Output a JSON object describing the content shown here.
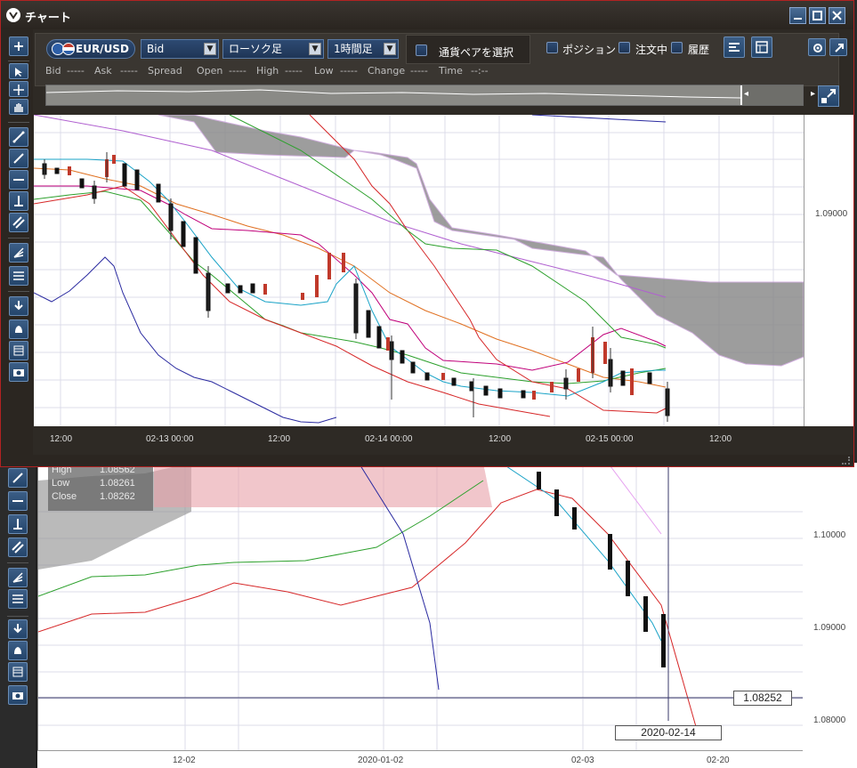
{
  "window": {
    "title": "チャート",
    "buttons": [
      "minimize",
      "maximize",
      "close"
    ]
  },
  "toolbar": {
    "pair": "EUR/USD",
    "price_type": "Bid",
    "chart_type": "ローソク足",
    "timeframe": "1時間足",
    "select_pair_label": "通貨ペアを選択",
    "position_label": "ポジション",
    "orders_label": "注文中",
    "history_label": "履歴"
  },
  "info_bar": {
    "bid_label": "Bid",
    "bid_value": "-----",
    "ask_label": "Ask",
    "ask_value": "-----",
    "spread_label": "Spread",
    "open_label": "Open",
    "open_value": "-----",
    "high_label": "High",
    "high_value": "-----",
    "low_label": "Low",
    "low_value": "-----",
    "change_label": "Change",
    "change_value": "-----",
    "time_label": "Time",
    "time_value": "--:--"
  },
  "chart": {
    "x_labels": [
      "12:00",
      "02-13 00:00",
      "12:00",
      "02-14 00:00",
      "12:00",
      "02-15 00:00",
      "12:00"
    ],
    "y_labels": [
      "1.09000"
    ],
    "colors": {
      "bullish": "#c0392b",
      "bearish": "#111111",
      "cloud": "#8c8c8c"
    }
  },
  "bg_chart": {
    "x_labels": [
      "12-02",
      "2020-01-02",
      "02-03",
      "02-20"
    ],
    "y_labels": [
      "1.10000",
      "1.09000",
      "1.08000"
    ],
    "price_tag": "1.08252",
    "date_tag": "2020-02-14",
    "tooltip": {
      "high_label": "High",
      "high_value": "1.08562",
      "low_label": "Low",
      "low_value": "1.08261",
      "close_label": "Close",
      "close_value": "1.08262"
    }
  }
}
